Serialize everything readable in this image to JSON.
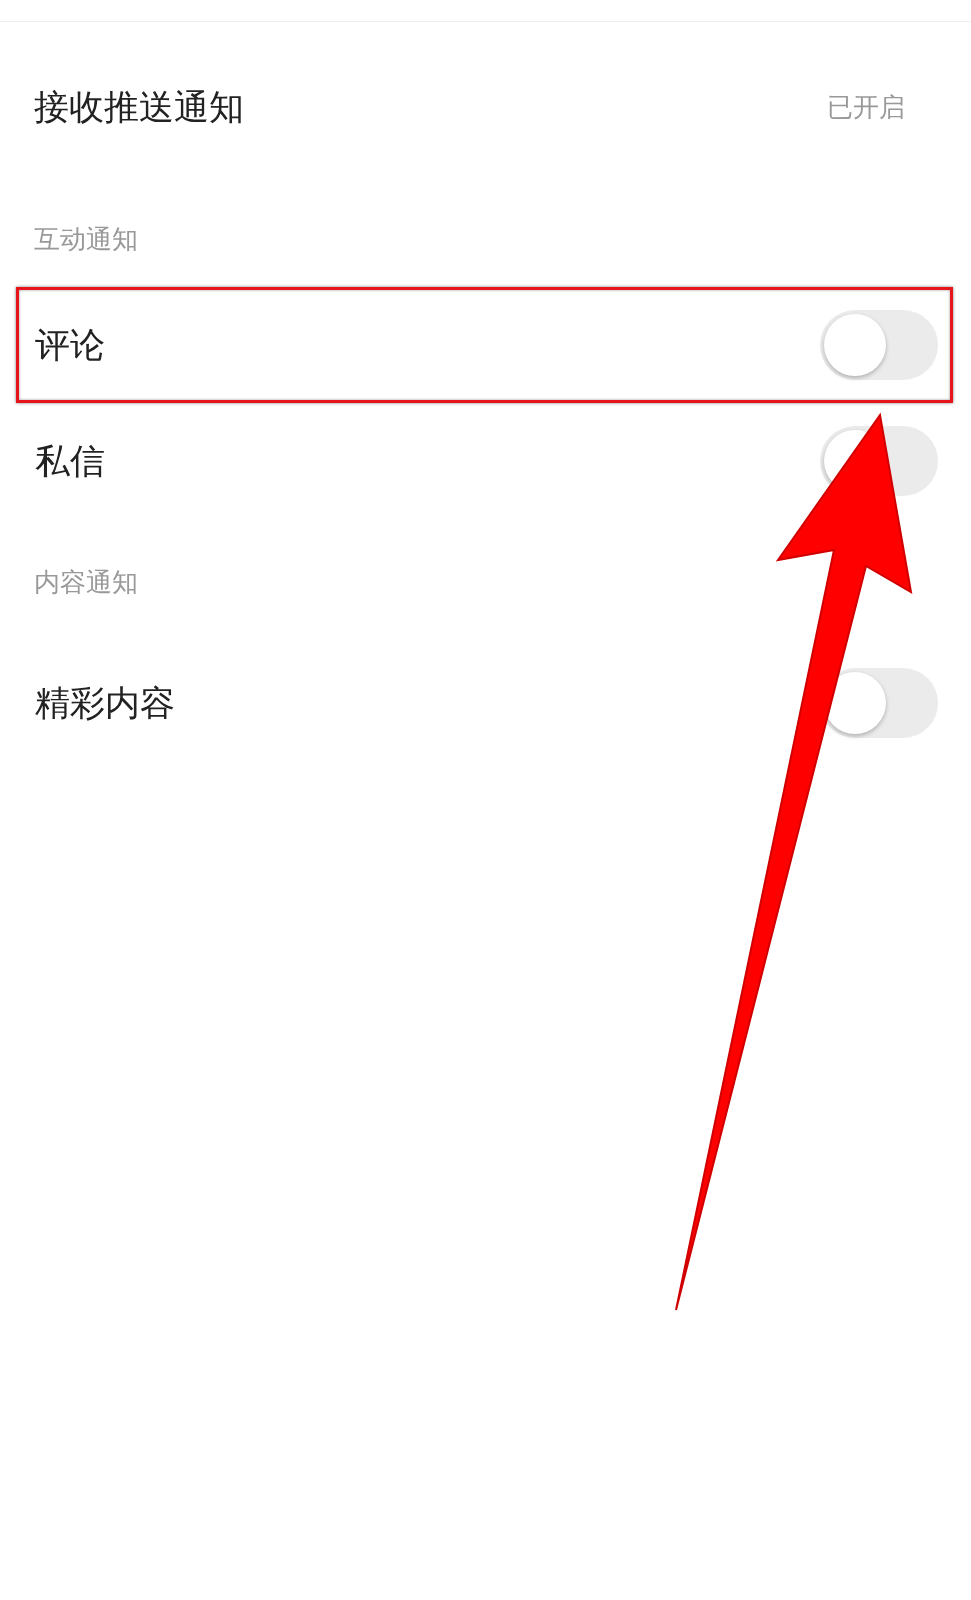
{
  "header": {
    "label": "接收推送通知",
    "value": "已开启"
  },
  "sections": [
    {
      "title": "互动通知",
      "items": [
        {
          "label": "评论",
          "on": false,
          "highlighted": true
        },
        {
          "label": "私信",
          "on": false,
          "highlighted": false
        }
      ]
    },
    {
      "title": "内容通知",
      "items": [
        {
          "label": "精彩内容",
          "on": false,
          "highlighted": false
        }
      ]
    }
  ],
  "arrow": true
}
